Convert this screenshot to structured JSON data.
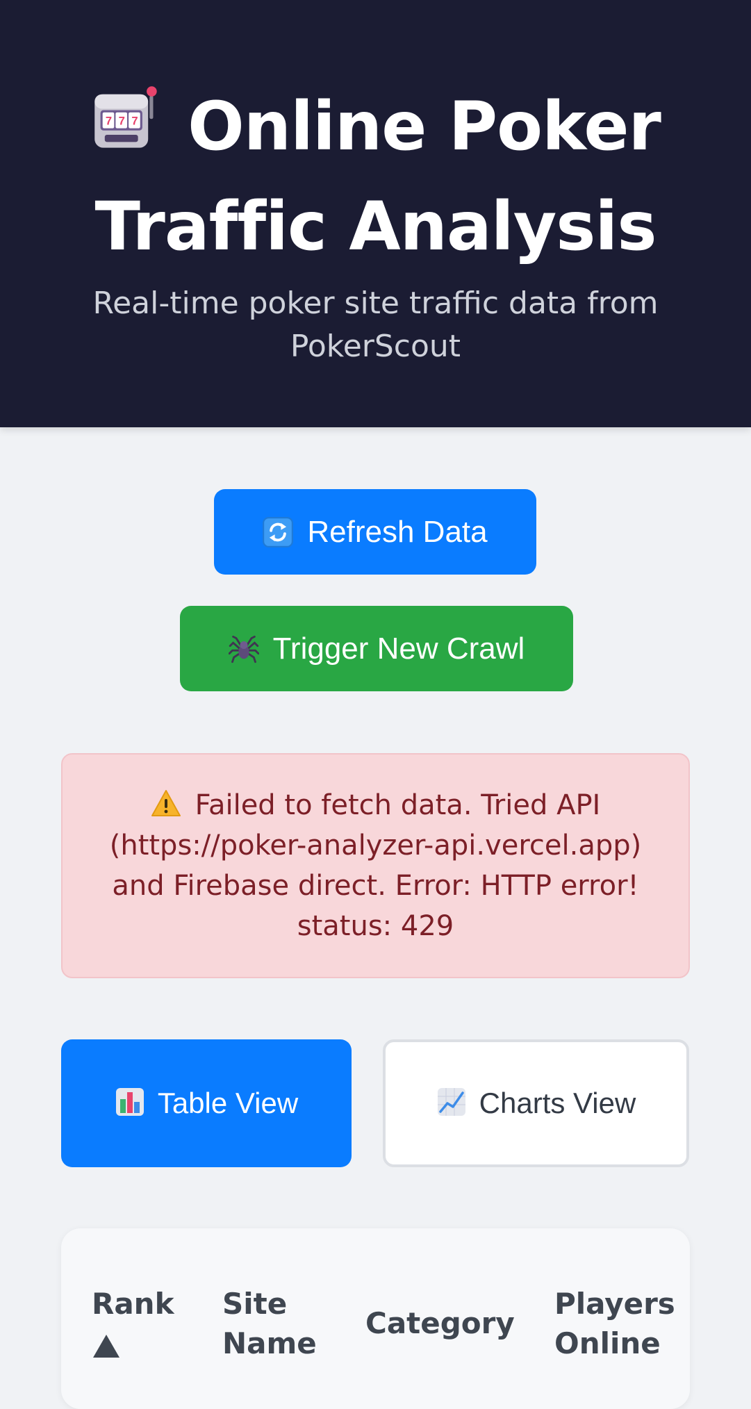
{
  "header": {
    "icon": "slot-machine-icon",
    "title": "Online Poker Traffic Analysis",
    "subtitle": "Real-time poker site traffic data from PokerScout",
    "background": "#1b1c33"
  },
  "actions": {
    "refresh": {
      "label": "Refresh Data",
      "icon": "refresh-icon",
      "color": "#0a7cff"
    },
    "crawl": {
      "label": "Trigger New Crawl",
      "icon": "spider-icon",
      "color": "#29a744"
    }
  },
  "error": {
    "icon": "warning-icon",
    "message": "Failed to fetch data. Tried API (https://poker-analyzer-api.vercel.app) and Firebase direct. Error: HTTP error! status: 429",
    "background": "#f8d7da",
    "text_color": "#7c1f27"
  },
  "view_toggle": {
    "active": "table",
    "table": {
      "label": "Table View",
      "icon": "bar-chart-icon"
    },
    "charts": {
      "label": "Charts View",
      "icon": "line-chart-icon"
    }
  },
  "table": {
    "sort_column": "rank",
    "sort_direction": "ascending",
    "columns": [
      {
        "key": "rank",
        "label": "Rank"
      },
      {
        "key": "site_name",
        "label": "Site Name"
      },
      {
        "key": "category",
        "label": "Category"
      },
      {
        "key": "players_online",
        "label": "Players Online"
      }
    ]
  }
}
